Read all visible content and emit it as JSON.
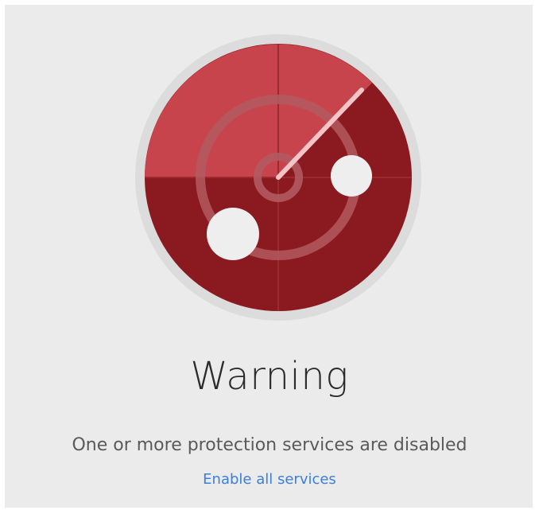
{
  "status": {
    "title": "Warning",
    "message": "One or more protection services are disabled",
    "action_label": "Enable all services"
  },
  "icon": {
    "name": "radar-warning-icon",
    "colors": {
      "base": "#8a1a20",
      "sweep": "#c8444c",
      "ring": "#d9d9d9",
      "blip": "#eeeeee",
      "needle": "#f4c4c6"
    }
  },
  "colors": {
    "background": "#ebebeb",
    "link": "#3d7fd6",
    "title": "#2b2b2b",
    "message": "#5a5a5a"
  }
}
